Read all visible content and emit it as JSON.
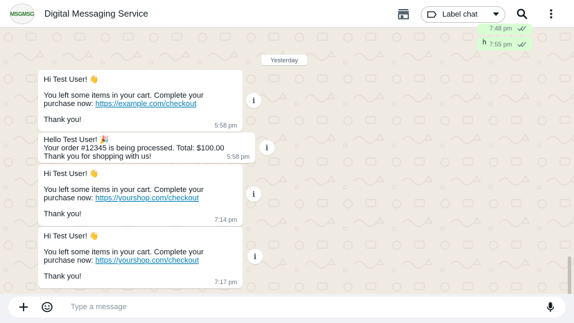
{
  "header": {
    "logo_text": "MSGMSG",
    "title": "Digital Messaging Service",
    "label_chat": "Label chat",
    "icons": [
      "storefront-icon",
      "label-icon",
      "chevron-down-icon",
      "search-icon",
      "more-vert-icon"
    ]
  },
  "outgoing": [
    {
      "text": "",
      "time": "7:48 pm"
    },
    {
      "text": "h",
      "time": "7:55 pm"
    }
  ],
  "date_separator": "Yesterday",
  "messages": [
    {
      "lines": [
        "Hi Test User! 👋",
        "",
        "You left some items in your cart. Complete your",
        "purchase now: ",
        "",
        "Thank you!"
      ],
      "link": "https://example.com/checkout",
      "time": "5:58 pm"
    },
    {
      "lines": [
        "Hello Test User! 🎉",
        "Your order #12345 is being processed. Total: $100.00",
        "Thank you for shopping with us!"
      ],
      "time": "5:58 pm"
    },
    {
      "lines": [
        "Hi Test User! 👋",
        "",
        "You left some items in your cart. Complete your",
        "purchase now: ",
        "",
        "Thank you!"
      ],
      "link": "https://yourshop.com/checkout",
      "time": "7:14 pm"
    },
    {
      "lines": [
        "Hi Test User! 👋",
        "",
        "You left some items in your cart. Complete your",
        "purchase now: ",
        "",
        "Thank you!"
      ],
      "link": "https://yourshop.com/checkout",
      "time": "7:17 pm"
    }
  ],
  "info_glyph": "i",
  "composer": {
    "placeholder": "Type a message",
    "icons": [
      "plus-icon",
      "sticker-icon",
      "mic-icon"
    ]
  },
  "colors": {
    "chat_bg": "#efeae2",
    "outgoing_bubble": "#d9fdd3",
    "incoming_bubble": "#ffffff",
    "link": "#027eb5",
    "tick": "#53bdeb"
  }
}
